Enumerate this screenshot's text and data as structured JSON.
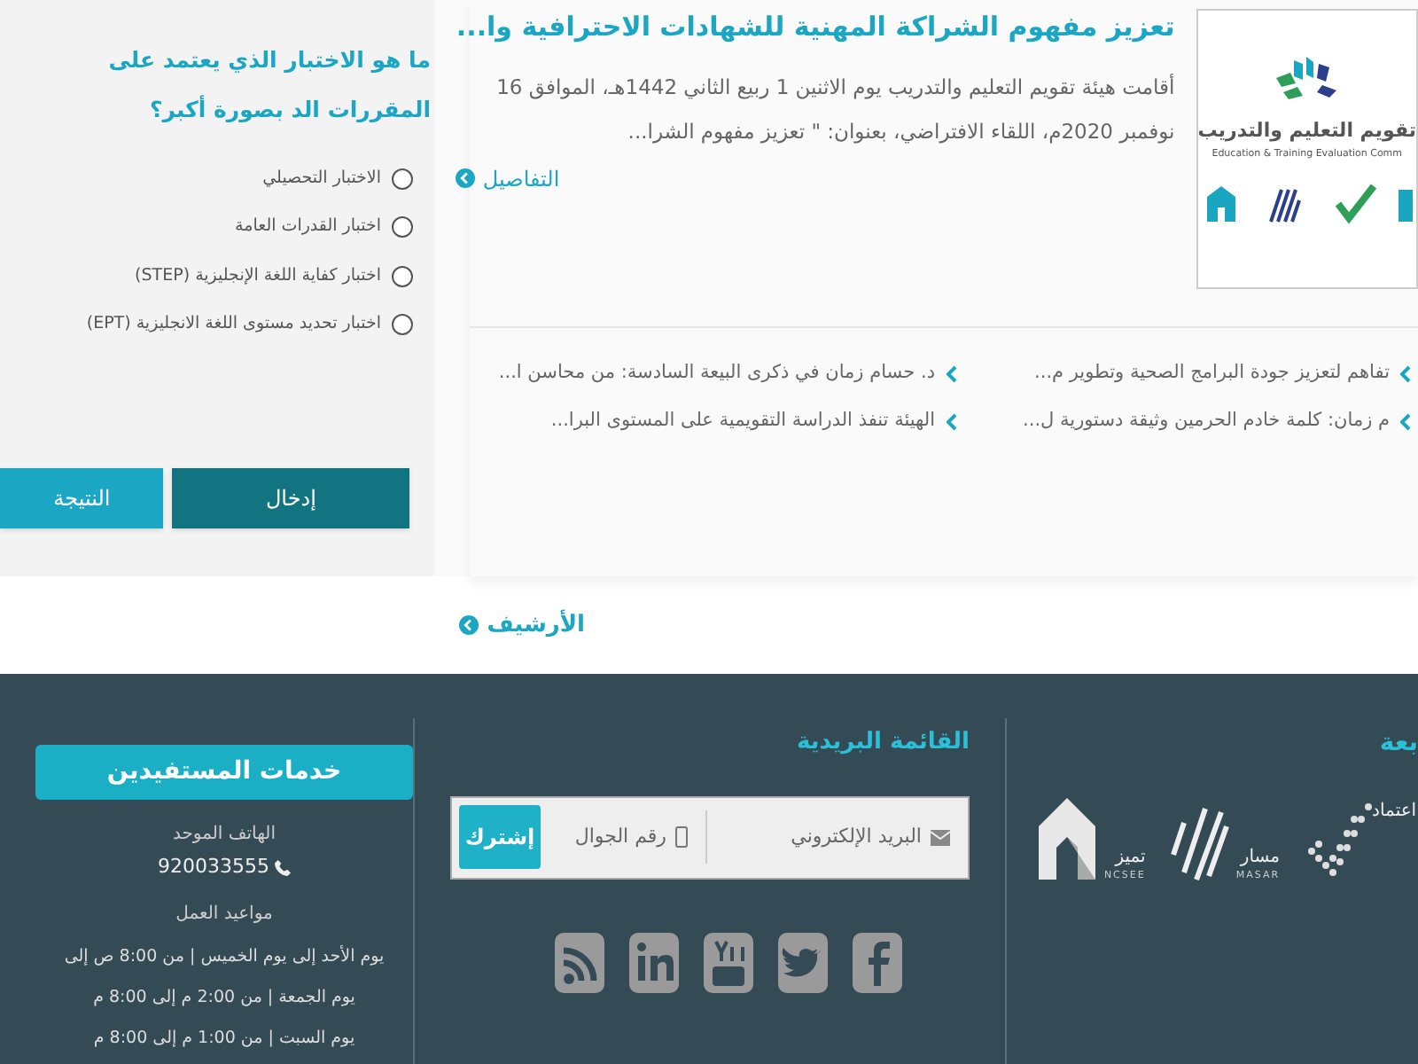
{
  "quiz": {
    "question": "ما هو الاختبار الذي يعتمد على المقررات الد بصورة أكبر؟",
    "options": [
      {
        "label": "الاختبار التحصيلي",
        "selected": false
      },
      {
        "label": "اختبار القدرات العامة",
        "selected": false
      },
      {
        "label": "اختبار كفاية اللغة الإنجليزية (STEP)",
        "selected": false
      },
      {
        "label": "اختبار تحديد مستوى اللغة الانجليزية (EPT)",
        "selected": false
      }
    ],
    "buttons": [
      {
        "label": "إدخال",
        "kind": "primary"
      },
      {
        "label": "النتيجة",
        "kind": "secondary"
      }
    ]
  },
  "featured": {
    "logo_title": "تقويم التعليم والتدريب",
    "logo_subtitle": "Education & Training Evaluation Comm",
    "title": "تعزيز مفهوم الشراكة المهنية للشهادات الاحترافية وا...",
    "summary": "أقامت هيئة تقويم التعليم والتدريب يوم الاثنين 1 ربيع الثاني 1442هـ، الموافق 16 نوفمبر 2020م، اللقاء الافتراضي، بعنوان: \" تعزيز مفهوم الشرا...",
    "details_link": "التفاصيل"
  },
  "news": [
    {
      "title": "تفاهم لتعزيز جودة البرامج الصحية وتطوير م..."
    },
    {
      "title": "د. حسام زمان في ذكرى البيعة السادسة: من محاسن ا..."
    },
    {
      "title": "م زمان: كلمة خادم الحرمين وثيقة دستورية ل..."
    },
    {
      "title": "الهيئة تنفذ الدراسة التقويمية على المستوى البرا..."
    }
  ],
  "archive_link": "الأرشيف",
  "footer": {
    "partners": {
      "heading": "بعة",
      "logos": [
        {
          "kind": "check",
          "name": "اعتماد"
        },
        {
          "kind": "stripes",
          "name": "مسار",
          "latin": "MASAR"
        },
        {
          "kind": "house",
          "name": "تميز",
          "latin": "NCSEE"
        }
      ]
    },
    "newsletter": {
      "heading": "القائمة البريدية",
      "email_placeholder": "البريد الإلكتروني",
      "mobile_placeholder": "رقم الجوال",
      "subscribe": "إشترك"
    },
    "services": {
      "heading": "خدمات المستفيدين",
      "phone_label": "الهاتف الموحد",
      "phone": "920033555",
      "hours_label": "مواعيد العمل",
      "hours": [
        "يوم الأحد إلى يوم الخميس | من 8:00 ص إلى",
        "يوم الجمعة | من 2:00 م إلى 8:00 م",
        "يوم السبت | من 1:00 م إلى 8:00 م"
      ]
    }
  }
}
